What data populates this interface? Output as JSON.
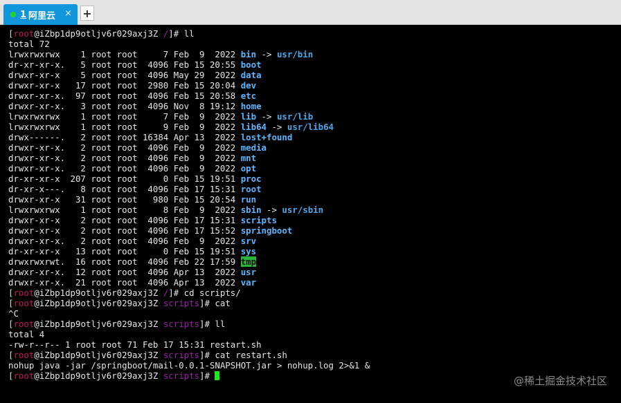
{
  "tab": {
    "number": "1",
    "title": "阿里云",
    "close": "×",
    "add": "+"
  },
  "watermark": "@稀土掘金技术社区",
  "colors": {
    "tab_active": "#1296db",
    "status_dot": "#22d626",
    "user": "#c2185b",
    "path": "#9c1fa8",
    "link_dir": "#5cb6ff",
    "highlight": "#2bb43a",
    "cursor": "#1de81d"
  },
  "terminal": {
    "lines": [
      [
        [
          "[",
          "br"
        ],
        [
          "root",
          "root"
        ],
        [
          "@iZbp1dp9otljv6r029axj3Z ",
          ""
        ],
        [
          "/",
          "dir"
        ],
        [
          "]# ll",
          ""
        ]
      ],
      [
        [
          "total 72",
          ""
        ]
      ],
      [
        [
          "lrwxrwxrwx    1 root root     7 Feb  9  2022 ",
          ""
        ],
        [
          "bin",
          "blue"
        ],
        [
          " -> ",
          ""
        ],
        [
          "usr/bin",
          "blue2"
        ]
      ],
      [
        [
          "dr-xr-xr-x.   5 root root  4096 Feb 15 20:55 ",
          ""
        ],
        [
          "boot",
          "blue"
        ]
      ],
      [
        [
          "drwxr-xr-x    5 root root  4096 May 29  2022 ",
          ""
        ],
        [
          "data",
          "blue"
        ]
      ],
      [
        [
          "drwxr-xr-x   17 root root  2980 Feb 15 20:04 ",
          ""
        ],
        [
          "dev",
          "blue"
        ]
      ],
      [
        [
          "drwxr-xr-x.  97 root root  4096 Feb 15 20:58 ",
          ""
        ],
        [
          "etc",
          "blue"
        ]
      ],
      [
        [
          "drwxr-xr-x.   3 root root  4096 Nov  8 19:12 ",
          ""
        ],
        [
          "home",
          "blue"
        ]
      ],
      [
        [
          "lrwxrwxrwx    1 root root     7 Feb  9  2022 ",
          ""
        ],
        [
          "lib",
          "blue"
        ],
        [
          " -> ",
          ""
        ],
        [
          "usr/lib",
          "blue2"
        ]
      ],
      [
        [
          "lrwxrwxrwx    1 root root     9 Feb  9  2022 ",
          ""
        ],
        [
          "lib64",
          "blue"
        ],
        [
          " -> ",
          ""
        ],
        [
          "usr/lib64",
          "blue2"
        ]
      ],
      [
        [
          "drwx------.   2 root root 16384 Apr 13  2022 ",
          ""
        ],
        [
          "lost+found",
          "blue"
        ]
      ],
      [
        [
          "drwxr-xr-x.   2 root root  4096 Feb  9  2022 ",
          ""
        ],
        [
          "media",
          "blue"
        ]
      ],
      [
        [
          "drwxr-xr-x.   2 root root  4096 Feb  9  2022 ",
          ""
        ],
        [
          "mnt",
          "blue"
        ]
      ],
      [
        [
          "drwxr-xr-x.   2 root root  4096 Feb  9  2022 ",
          ""
        ],
        [
          "opt",
          "blue"
        ]
      ],
      [
        [
          "dr-xr-xr-x  207 root root     0 Feb 15 19:51 ",
          ""
        ],
        [
          "proc",
          "blue"
        ]
      ],
      [
        [
          "dr-xr-x---.   8 root root  4096 Feb 17 15:31 ",
          ""
        ],
        [
          "root",
          "blue"
        ]
      ],
      [
        [
          "drwxr-xr-x   31 root root   980 Feb 15 20:54 ",
          ""
        ],
        [
          "run",
          "blue"
        ]
      ],
      [
        [
          "lrwxrwxrwx    1 root root     8 Feb  9  2022 ",
          ""
        ],
        [
          "sbin",
          "blue"
        ],
        [
          " -> ",
          ""
        ],
        [
          "usr/sbin",
          "blue2"
        ]
      ],
      [
        [
          "drwxr-xr-x    2 root root  4096 Feb 17 15:31 ",
          ""
        ],
        [
          "scripts",
          "blue"
        ]
      ],
      [
        [
          "drwxr-xr-x    2 root root  4096 Feb 17 15:52 ",
          ""
        ],
        [
          "springboot",
          "blue"
        ]
      ],
      [
        [
          "drwxr-xr-x.   2 root root  4096 Feb  9  2022 ",
          ""
        ],
        [
          "srv",
          "blue"
        ]
      ],
      [
        [
          "dr-xr-xr-x   13 root root     0 Feb 15 19:51 ",
          ""
        ],
        [
          "sys",
          "blue"
        ]
      ],
      [
        [
          "drwxrwxrwt.  16 root root  4096 Feb 22 17:59 ",
          ""
        ],
        [
          "tmp",
          "tmp"
        ]
      ],
      [
        [
          "drwxr-xr-x.  12 root root  4096 Apr 13  2022 ",
          ""
        ],
        [
          "usr",
          "blue"
        ]
      ],
      [
        [
          "drwxr-xr-x.  21 root root  4096 Apr 13  2022 ",
          ""
        ],
        [
          "var",
          "blue"
        ]
      ],
      [
        [
          "[",
          "br"
        ],
        [
          "root",
          "root"
        ],
        [
          "@iZbp1dp9otljv6r029axj3Z ",
          ""
        ],
        [
          "/",
          "dir"
        ],
        [
          "]# cd scripts/",
          ""
        ]
      ],
      [
        [
          "[",
          "br"
        ],
        [
          "root",
          "root"
        ],
        [
          "@iZbp1dp9otljv6r029axj3Z ",
          ""
        ],
        [
          "scripts",
          "dir"
        ],
        [
          "]# cat",
          ""
        ]
      ],
      [
        [
          "^C",
          ""
        ]
      ],
      [
        [
          "[",
          "br"
        ],
        [
          "root",
          "root"
        ],
        [
          "@iZbp1dp9otljv6r029axj3Z ",
          ""
        ],
        [
          "scripts",
          "dir"
        ],
        [
          "]# ll",
          ""
        ]
      ],
      [
        [
          "total 4",
          ""
        ]
      ],
      [
        [
          "-rw-r--r-- 1 root root 71 Feb 17 15:31 restart.sh",
          ""
        ]
      ],
      [
        [
          "[",
          "br"
        ],
        [
          "root",
          "root"
        ],
        [
          "@iZbp1dp9otljv6r029axj3Z ",
          ""
        ],
        [
          "scripts",
          "dir"
        ],
        [
          "]# cat restart.sh",
          ""
        ]
      ],
      [
        [
          "nohup java -jar /springboot/mail-0.0.1-SNAPSHOT.jar > nohup.log 2>&1 &",
          ""
        ]
      ],
      [
        [
          "[",
          "br"
        ],
        [
          "root",
          "root"
        ],
        [
          "@iZbp1dp9otljv6r029axj3Z ",
          ""
        ],
        [
          "scripts",
          "dir"
        ],
        [
          "]# ",
          ""
        ],
        [
          "",
          "cursor"
        ]
      ]
    ]
  }
}
